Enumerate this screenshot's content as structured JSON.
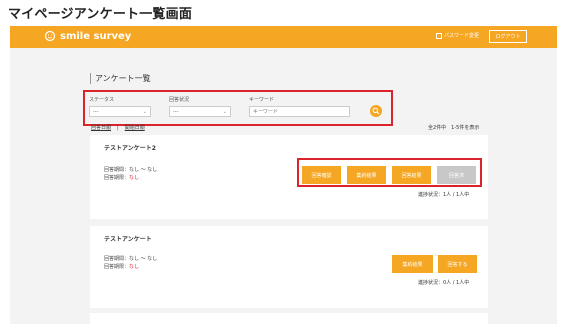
{
  "caption": "マイページアンケート一覧画面",
  "header": {
    "logo_text": "smile survey",
    "password_change": "パスワード変更",
    "logout": "ログアウト"
  },
  "list_title": "アンケート一覧",
  "search": {
    "status_label": "ステータス",
    "status_value": "---",
    "answer_status_label": "回答状況",
    "answer_status_value": "---",
    "keyword_label": "キーワード",
    "keyword_placeholder": "キーワード"
  },
  "sort": {
    "answer_date": "回答日順",
    "separator": "|",
    "end_date": "開始日順"
  },
  "count_text": "全2件中　1-5件を表示",
  "surveys": [
    {
      "title": "テストアンケート2",
      "period_label": "回答期間：なし 〜 なし",
      "deadline_prefix": "回答期限：",
      "deadline_value": "なし",
      "buttons": [
        "回答確認",
        "集約結果",
        "回答結果",
        "回答済"
      ],
      "progress": "進捗状況：1人 / 1人中"
    },
    {
      "title": "テストアンケート",
      "period_label": "回答期間：なし 〜 なし",
      "deadline_prefix": "回答期限：",
      "deadline_value": "なし",
      "buttons": [
        "集約結果",
        "回答する"
      ],
      "progress": "進捗状況：0人 / 1人中"
    }
  ],
  "colors": {
    "accent": "#f5a623",
    "highlight": "#d9232d",
    "disabled": "#c8c8c8"
  }
}
